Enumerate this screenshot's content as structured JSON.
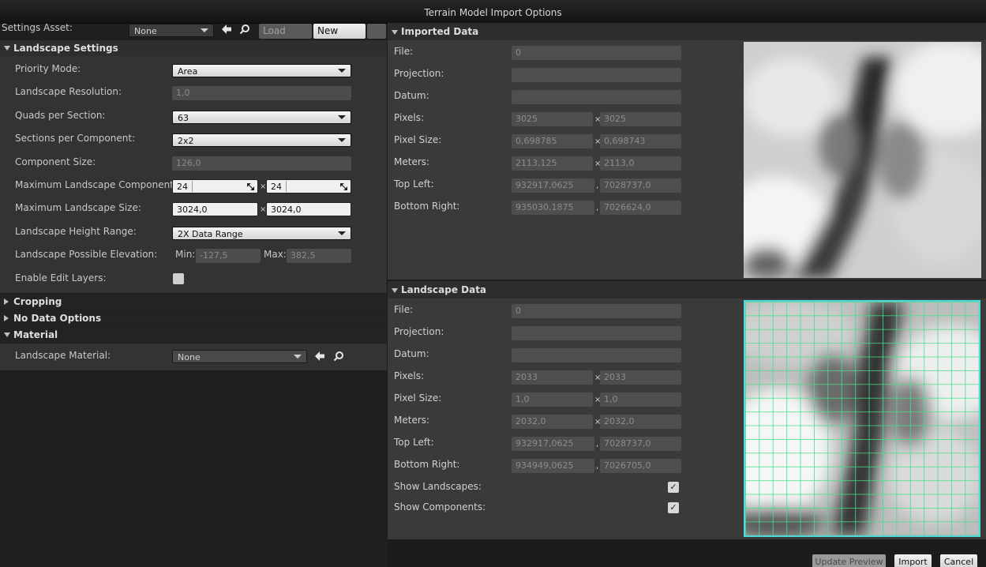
{
  "window": {
    "title": "Terrain Model Import Options"
  },
  "settings_asset": {
    "label": "Settings Asset:",
    "value": "None",
    "load_label": "Load",
    "new_label": "New"
  },
  "landscape_settings": {
    "header": "Landscape Settings",
    "priority_mode": {
      "label": "Priority Mode:",
      "value": "Area"
    },
    "resolution": {
      "label": "Landscape Resolution:",
      "value": "1,0"
    },
    "quads_per_section": {
      "label": "Quads per Section:",
      "value": "63"
    },
    "sections_per_component": {
      "label": "Sections per Component:",
      "value": "2x2"
    },
    "component_size": {
      "label": "Component Size:",
      "value": "126,0"
    },
    "max_components": {
      "label": "Maximum Landscape Components:",
      "x": "24",
      "y": "24"
    },
    "max_size": {
      "label": "Maximum Landscape Size:",
      "x": "3024,0",
      "y": "3024,0"
    },
    "height_range": {
      "label": "Landscape Height Range:",
      "value": "2X Data Range"
    },
    "possible_elevation": {
      "label": "Landscape Possible Elevation:",
      "min_label": "Min:",
      "min": "-127,5",
      "max_label": "Max:",
      "max": "382,5"
    },
    "edit_layers": {
      "label": "Enable Edit Layers:",
      "checked": false
    }
  },
  "sections": {
    "cropping": "Cropping",
    "no_data": "No Data Options",
    "material": "Material"
  },
  "material": {
    "label": "Landscape Material:",
    "value": "None"
  },
  "separator_x": "×",
  "separator_comma": ",",
  "imported": {
    "header": "Imported Data",
    "file_label": "File:",
    "file": "0",
    "projection_label": "Projection:",
    "projection": "",
    "datum_label": "Datum:",
    "datum": "",
    "pixels_label": "Pixels:",
    "pixels_x": "3025",
    "pixels_y": "3025",
    "pixel_size_label": "Pixel Size:",
    "pixel_size_x": "0,698785",
    "pixel_size_y": "0,698743",
    "meters_label": "Meters:",
    "meters_x": "2113,125",
    "meters_y": "2113,0",
    "top_left_label": "Top Left:",
    "top_left_x": "932917,0625",
    "top_left_y": "7028737,0",
    "bottom_right_label": "Bottom Right:",
    "bottom_right_x": "935030,1875",
    "bottom_right_y": "7026624,0"
  },
  "landscape": {
    "header": "Landscape Data",
    "file_label": "File:",
    "file": "0",
    "projection_label": "Projection:",
    "projection": "",
    "datum_label": "Datum:",
    "datum": "",
    "pixels_label": "Pixels:",
    "pixels_x": "2033",
    "pixels_y": "2033",
    "pixel_size_label": "Pixel Size:",
    "pixel_size_x": "1,0",
    "pixel_size_y": "1,0",
    "meters_label": "Meters:",
    "meters_x": "2032,0",
    "meters_y": "2032,0",
    "top_left_label": "Top Left:",
    "top_left_x": "932917,0625",
    "top_left_y": "7028737,0",
    "bottom_right_label": "Bottom Right:",
    "bottom_right_x": "934949,0625",
    "bottom_right_y": "7026705,0",
    "show_landscapes_label": "Show Landscapes:",
    "show_landscapes": true,
    "show_components_label": "Show Components:",
    "show_components": true
  },
  "buttons": {
    "update_preview": "Update Preview",
    "import": "Import",
    "cancel": "Cancel"
  },
  "colors": {
    "grid": "#3fe28a",
    "preview_border": "#4fd8d8"
  }
}
